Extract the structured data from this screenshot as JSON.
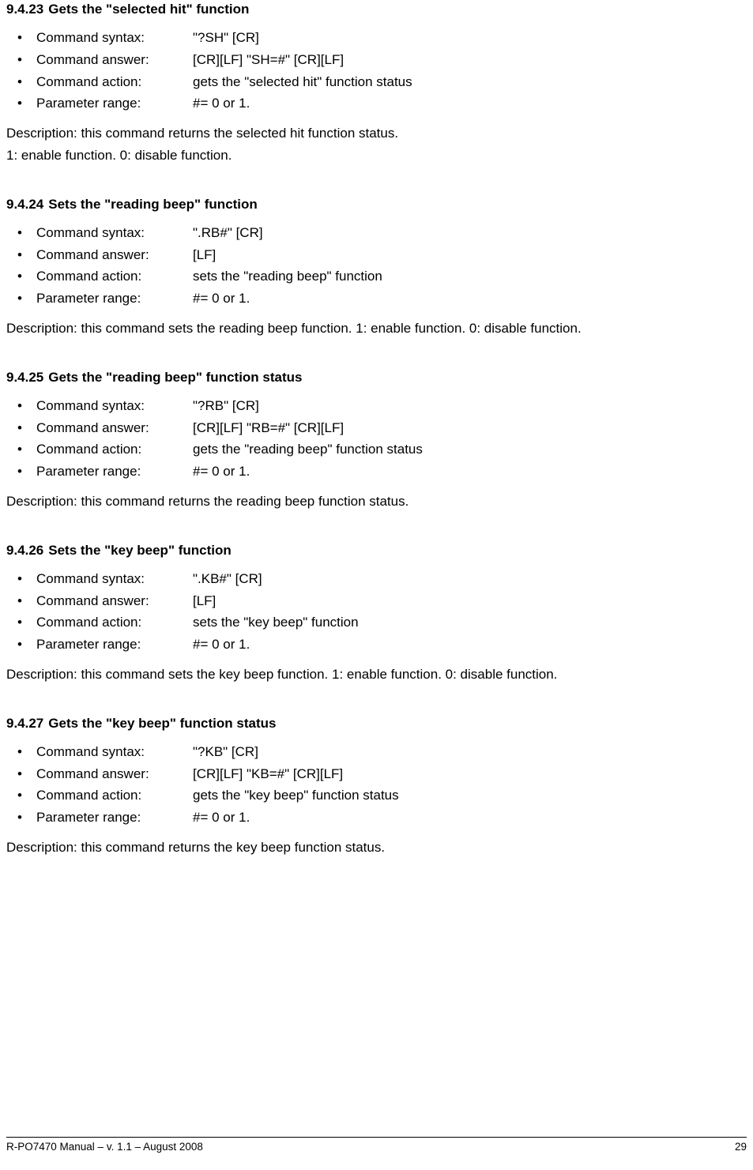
{
  "sections": [
    {
      "number": "9.4.23",
      "title": "Gets the \"selected hit\" function",
      "items": [
        {
          "label": "Command syntax:",
          "value": "\"?SH\" [CR]"
        },
        {
          "label": "Command answer:",
          "value": "[CR][LF] \"SH=#\" [CR][LF]"
        },
        {
          "label": "Command action:",
          "value": "gets the \"selected hit\" function status"
        },
        {
          "label": "Parameter range:",
          "value": "#= 0 or 1."
        }
      ],
      "descriptions": [
        "Description: this command returns the selected hit function status.",
        "1: enable function. 0: disable function."
      ]
    },
    {
      "number": "9.4.24",
      "title": "Sets the \"reading beep\" function",
      "items": [
        {
          "label": "Command syntax:",
          "value": "\".RB#\" [CR]"
        },
        {
          "label": "Command answer:",
          "value": "[LF]"
        },
        {
          "label": "Command action:",
          "value": "sets the \"reading beep\" function"
        },
        {
          "label": "Parameter range:",
          "value": "#= 0 or 1."
        }
      ],
      "descriptions": [
        "Description: this command sets the reading beep function. 1: enable function. 0: disable function."
      ]
    },
    {
      "number": "9.4.25",
      "title": "Gets the \"reading beep\" function status",
      "items": [
        {
          "label": "Command syntax:",
          "value": "\"?RB\" [CR]"
        },
        {
          "label": "Command answer:",
          "value": "[CR][LF] \"RB=#\" [CR][LF]"
        },
        {
          "label": "Command action:",
          "value": "gets the \"reading beep\" function status"
        },
        {
          "label": "Parameter range:",
          "value": "#= 0 or 1."
        }
      ],
      "descriptions": [
        "Description: this command returns the reading beep function status."
      ]
    },
    {
      "number": "9.4.26",
      "title": "Sets the \"key beep\" function",
      "items": [
        {
          "label": "Command syntax:",
          "value": "\".KB#\" [CR]"
        },
        {
          "label": "Command answer:",
          "value": "[LF]"
        },
        {
          "label": "Command action:",
          "value": "sets the \"key beep\" function"
        },
        {
          "label": "Parameter range:",
          "value": "#= 0 or 1."
        }
      ],
      "descriptions": [
        "Description: this command sets the key beep function. 1: enable function. 0: disable function."
      ]
    },
    {
      "number": "9.4.27",
      "title": "Gets the \"key beep\" function status",
      "items": [
        {
          "label": "Command syntax:",
          "value": "\"?KB\" [CR]"
        },
        {
          "label": "Command answer:",
          "value": "[CR][LF] \"KB=#\" [CR][LF]"
        },
        {
          "label": "Command action:",
          "value": "gets the \"key beep\" function status"
        },
        {
          "label": "Parameter range:",
          "value": "#= 0 or 1."
        }
      ],
      "descriptions": [
        "Description: this command returns the key beep function status."
      ]
    }
  ],
  "footer": {
    "left": "R-PO7470 Manual – v. 1.1 – August 2008",
    "right": "29"
  }
}
